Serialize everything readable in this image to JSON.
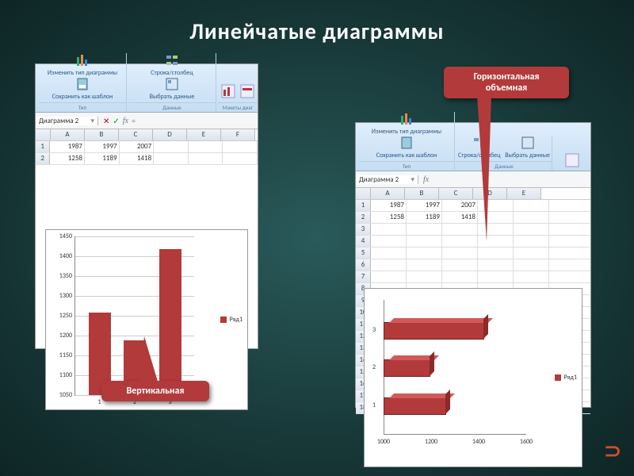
{
  "title": "Линейчатые   диаграммы",
  "ribbon": {
    "b1": "Изменить тип\nдиаграммы",
    "b2": "Сохранить\nкак шаблон",
    "b3": "Строка/столбец",
    "b3b": "Строка/столбец",
    "b4": "Выбрать\nданные",
    "g1": "Тип",
    "g2": "Данные",
    "g3": "Макеты диаг"
  },
  "namebox": {
    "name": "Диаграмма 2",
    "formula": "="
  },
  "cols": [
    "A",
    "B",
    "C",
    "D",
    "E",
    "F"
  ],
  "table": [
    [
      "1987",
      "1997",
      "2007"
    ],
    [
      "1258",
      "1189",
      "1418"
    ]
  ],
  "callouts": {
    "vertical": "Вертикальная",
    "horizontal3d": "Горизонтальная объемная"
  },
  "chart_data": [
    {
      "type": "bar",
      "orientation": "vertical",
      "categories": [
        "1",
        "2",
        "3"
      ],
      "series": [
        {
          "name": "Ряд1",
          "values": [
            1258,
            1189,
            1418
          ]
        }
      ],
      "ylim": [
        1050,
        1450
      ],
      "yticks": [
        1050,
        1100,
        1150,
        1200,
        1250,
        1300,
        1350,
        1400,
        1450
      ]
    },
    {
      "type": "bar",
      "orientation": "horizontal-3d",
      "categories": [
        "1",
        "2",
        "3"
      ],
      "series": [
        {
          "name": "Ряд1",
          "values": [
            1258,
            1189,
            1418
          ]
        }
      ],
      "xlim": [
        1000,
        1600
      ],
      "xticks": [
        1000,
        1200,
        1400,
        1600
      ]
    }
  ]
}
